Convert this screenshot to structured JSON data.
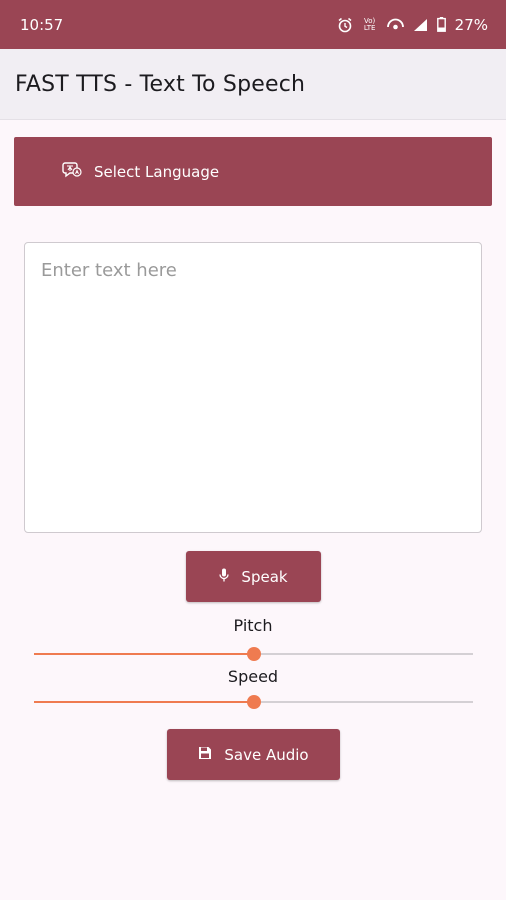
{
  "status_bar": {
    "time": "10:57",
    "network_label": "Vo) LTE",
    "battery_percent": "27%"
  },
  "app_bar": {
    "title": "FAST TTS - Text To Speech"
  },
  "language": {
    "button_label": "Select Language",
    "icon": "translate-icon"
  },
  "text_input": {
    "value": "",
    "placeholder": "Enter text here"
  },
  "speak": {
    "label": "Speak",
    "icon": "microphone-icon"
  },
  "pitch": {
    "label": "Pitch",
    "value": 0.5
  },
  "speed": {
    "label": "Speed",
    "value": 0.5
  },
  "save_audio": {
    "label": "Save Audio",
    "icon": "save-icon"
  },
  "colors": {
    "primary": "#9a4554",
    "slider_accent": "#ef7b50",
    "background": "#fdf7fb",
    "app_bar": "#f1eef3"
  }
}
